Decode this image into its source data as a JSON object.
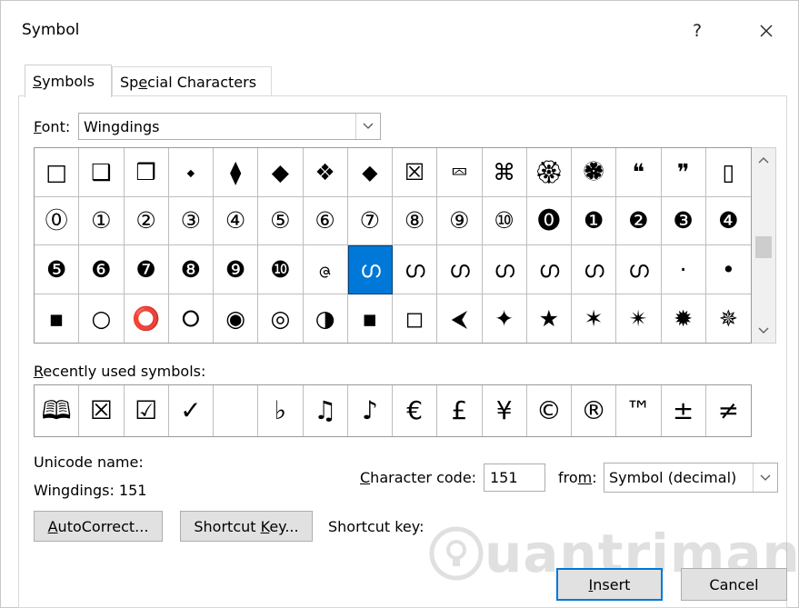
{
  "window": {
    "title": "Symbol",
    "help_label": "?",
    "close_label": "✕"
  },
  "tabs": [
    {
      "prefix": "",
      "key": "S",
      "rest": "ymbols",
      "active": true
    },
    {
      "prefix": "Sp",
      "key": "e",
      "rest": "cial Characters",
      "active": false
    }
  ],
  "font": {
    "label_key": "F",
    "label_rest": "ont:",
    "value": "Wingdings"
  },
  "symbol_grid": [
    [
      "□",
      "❑",
      "❒",
      "⬩",
      "⧫",
      "◆",
      "❖",
      "⬥",
      "☒",
      "⮹",
      "⌘",
      "🏵",
      "🏶",
      "❝",
      "❞",
      "▯"
    ],
    [
      "⓪",
      "①",
      "②",
      "③",
      "④",
      "⑤",
      "⑥",
      "⑦",
      "⑧",
      "⑨",
      "⑩",
      "⓿",
      "❶",
      "❷",
      "❸",
      "❹"
    ],
    [
      "❺",
      "❻",
      "❼",
      "❽",
      "❾",
      "❿",
      "ဇ",
      "ഗ",
      "ഗ",
      "ഗ",
      "ഗ",
      "ഗ",
      "ഗ",
      "ഗ",
      "·",
      "•"
    ],
    [
      "▪",
      "○",
      "⭕",
      "⭘",
      "◉",
      "◎",
      "◑",
      "▪",
      "◻",
      "⮜",
      "✦",
      "★",
      "✶",
      "✴",
      "✹",
      "✵"
    ]
  ],
  "selected": {
    "row": 2,
    "col": 7
  },
  "recent": {
    "label_key": "R",
    "label_rest": "ecently used symbols:",
    "symbols": [
      "🕮",
      "☒",
      "☑",
      "✓",
      "",
      "♭",
      "♫",
      "♪",
      "€",
      "£",
      "¥",
      "©",
      "®",
      "™",
      "±",
      "≠"
    ]
  },
  "unicode": {
    "label": "Unicode name:",
    "value": "Wingdings: 151"
  },
  "charcode": {
    "label_key": "C",
    "label_rest": "haracter code:",
    "value": "151",
    "from_prefix": "fro",
    "from_key": "m",
    "from_rest": ":",
    "from_value": "Symbol (decimal)"
  },
  "buttons": {
    "autocorrect_key": "A",
    "autocorrect_rest": "utoCorrect...",
    "shortcut_prefix": "Shortcut ",
    "shortcut_key": "K",
    "shortcut_rest": "ey...",
    "insert_key": "I",
    "insert_rest": "nsert",
    "cancel": "Cancel"
  },
  "shortcut_key_label": "Shortcut key:",
  "watermark": "uantrimang"
}
